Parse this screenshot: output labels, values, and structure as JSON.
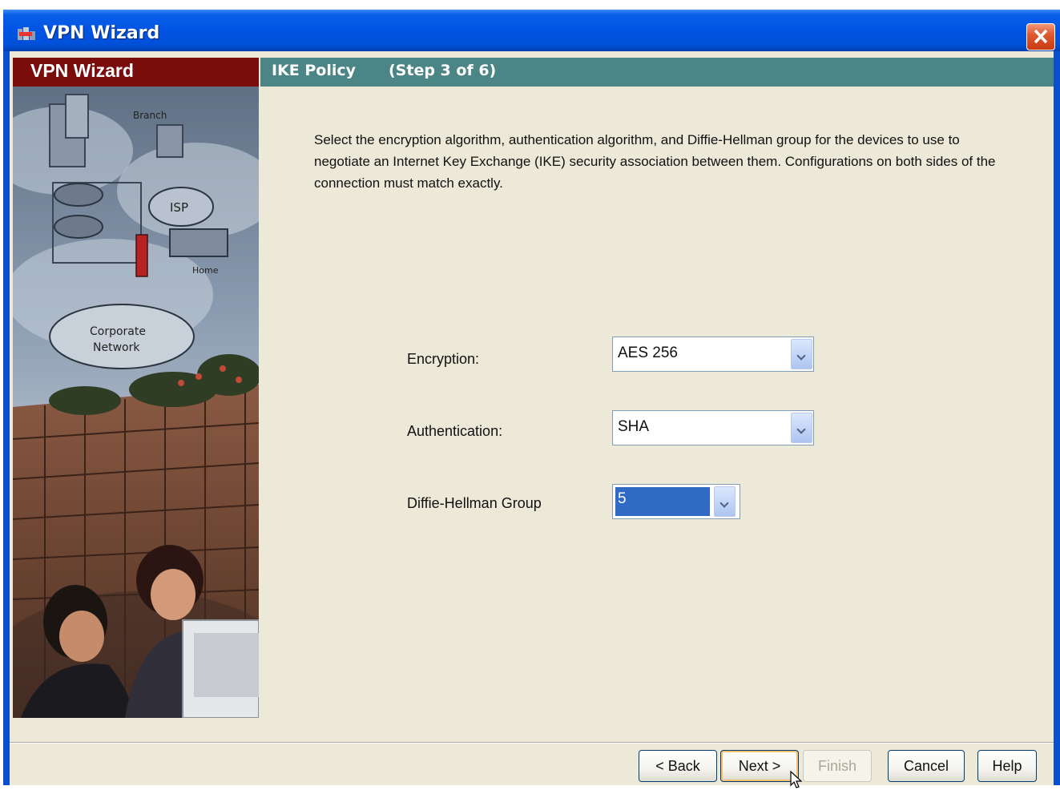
{
  "window": {
    "title": "VPN Wizard",
    "close_icon": "close-icon"
  },
  "wizard": {
    "left_header": "VPN Wizard",
    "page_title": "IKE Policy",
    "step": "(Step 3 of 6)"
  },
  "description": "Select the encryption algorithm, authentication algorithm, and Diffie-Hellman group for the devices to use to negotiate an Internet Key Exchange (IKE) security association between them. Configurations on both sides of the connection must match exactly.",
  "illustration": {
    "labels": [
      "Branch",
      "ISP",
      "Home",
      "Corporate Network"
    ]
  },
  "form": {
    "encryption": {
      "label": "Encryption:",
      "value": "AES 256"
    },
    "authentication": {
      "label": "Authentication:",
      "value": "SHA"
    },
    "dh_group": {
      "label": "Diffie-Hellman Group",
      "value": "5"
    }
  },
  "buttons": {
    "back": "< Back",
    "next": "Next >",
    "finish": "Finish",
    "cancel": "Cancel",
    "help": "Help"
  },
  "colors": {
    "titlebar": "#0054e3",
    "left_header": "#7a0c0c",
    "step_header": "#4c8585",
    "dialog_bg": "#ece9d8",
    "selection": "#316ac5"
  }
}
